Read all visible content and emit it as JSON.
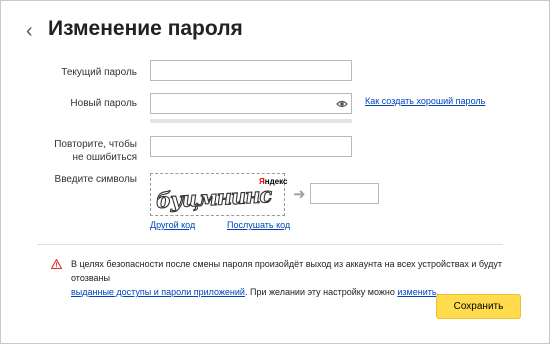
{
  "title": "Изменение пароля",
  "back_icon": "chevron-left-icon",
  "fields": {
    "current_label": "Текущий пароль",
    "new_label": "Новый пароль",
    "repeat_label_1": "Повторите, чтобы",
    "repeat_label_2": "не ошибиться",
    "captcha_label": "Введите символы"
  },
  "links": {
    "good_password": "Как создать хороший пароль",
    "other_code": "Другой код",
    "listen_code": "Послушать код"
  },
  "captcha": {
    "brand_y": "Я",
    "brand_rest": "ндекс",
    "text": "буцмнинс"
  },
  "warning": {
    "text_1": "В целях безопасности после смены пароля произойдёт выход из аккаунта на всех устройствах и будут отозваны",
    "link_1": "выданные доступы и пароли приложений",
    "text_2": ". При желании эту настройку можно ",
    "link_2": "изменить",
    "text_3": "."
  },
  "save_label": "Сохранить",
  "colors": {
    "accent": "#ffdb4d",
    "link": "#0044bb",
    "warning": "#e4312b"
  }
}
